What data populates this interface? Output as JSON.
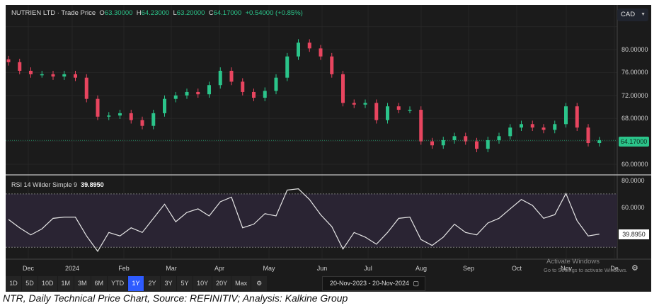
{
  "header": {
    "instrument": "NUTRIEN LTD",
    "separator": " · ",
    "price_type": "Trade Price",
    "open_label": "O",
    "open": "63.30000",
    "high_label": "H",
    "high": "64.23000",
    "low_label": "L",
    "low": "63.20000",
    "close_label": "C",
    "close": "64.17000",
    "change": "+0.54000 (+0.85%)",
    "currency": "CAD"
  },
  "colors": {
    "up": "#2bc48a",
    "down": "#e8455f",
    "background": "#1b1b1b",
    "rsi_band": "#2a2433",
    "accent": "#2e5bff"
  },
  "rsi": {
    "label": "RSI 14 Wilder Simple 9",
    "value": "39.8950",
    "axis": [
      "80.0000",
      "60.0000"
    ],
    "upper": 70,
    "lower": 30
  },
  "chart_data": {
    "type": "candlestick",
    "title": "NUTRIEN LTD - Trade Price",
    "ylim": [
      58,
      84
    ],
    "yticks": [
      "80.00000",
      "76.00000",
      "72.00000",
      "68.00000",
      "60.00000"
    ],
    "last_price": "64.17000",
    "xticks": [
      "Dec",
      "2024",
      "Feb",
      "Mar",
      "Apr",
      "May",
      "Jun",
      "Jul",
      "Aug",
      "Sep",
      "Oct",
      "Nov",
      "De"
    ],
    "close": [
      77.8,
      76.3,
      75.7,
      75.7,
      75.3,
      75.7,
      75.1,
      71.4,
      68.3,
      68.5,
      68.9,
      67.7,
      66.7,
      68.9,
      71.4,
      72.0,
      72.6,
      72.2,
      73.8,
      76.3,
      74.4,
      72.6,
      71.6,
      72.8,
      75.1,
      78.8,
      81.2,
      80.2,
      78.8,
      75.7,
      70.7,
      70.4,
      70.7,
      67.7,
      70.1,
      69.5,
      69.5,
      64.0,
      63.3,
      64.2,
      64.9,
      64.0,
      62.7,
      64.2,
      64.9,
      66.4,
      67.0,
      66.4,
      66.0,
      67.0,
      70.1,
      66.4,
      63.7,
      64.17
    ],
    "rsi_series": [
      50.8,
      44.6,
      39.3,
      43.8,
      51.7,
      52.6,
      52.6,
      38.5,
      27.0,
      41.1,
      38.5,
      44.6,
      41.1,
      51.7,
      62.3,
      49.1,
      56.1,
      58.8,
      53.5,
      64.1,
      67.6,
      44.6,
      47.3,
      55.2,
      53.5,
      72.9,
      73.8,
      65.8,
      54.4,
      45.5,
      28.7,
      41.1,
      37.6,
      32.3,
      41.1,
      51.7,
      52.6,
      35.8,
      31.4,
      37.6,
      47.3,
      41.1,
      39.3,
      48.2,
      51.7,
      58.8,
      65.8,
      61.4,
      51.7,
      54.4,
      70.3,
      49.9,
      38.5,
      39.895
    ]
  },
  "toolbar": {
    "ranges": [
      "1D",
      "5D",
      "10D",
      "1M",
      "3M",
      "6M",
      "YTD",
      "1Y",
      "2Y",
      "3Y",
      "5Y",
      "10Y",
      "20Y",
      "Max"
    ],
    "active": "1Y",
    "date_range": "20-Nov-2023 - 20-Nov-2024"
  },
  "watermark": {
    "line1": "Activate Windows",
    "line2": "Go to Settings to activate Windows."
  },
  "caption": "NTR, Daily Technical Price Chart, Source: REFINITIV; Analysis: Kalkine Group"
}
